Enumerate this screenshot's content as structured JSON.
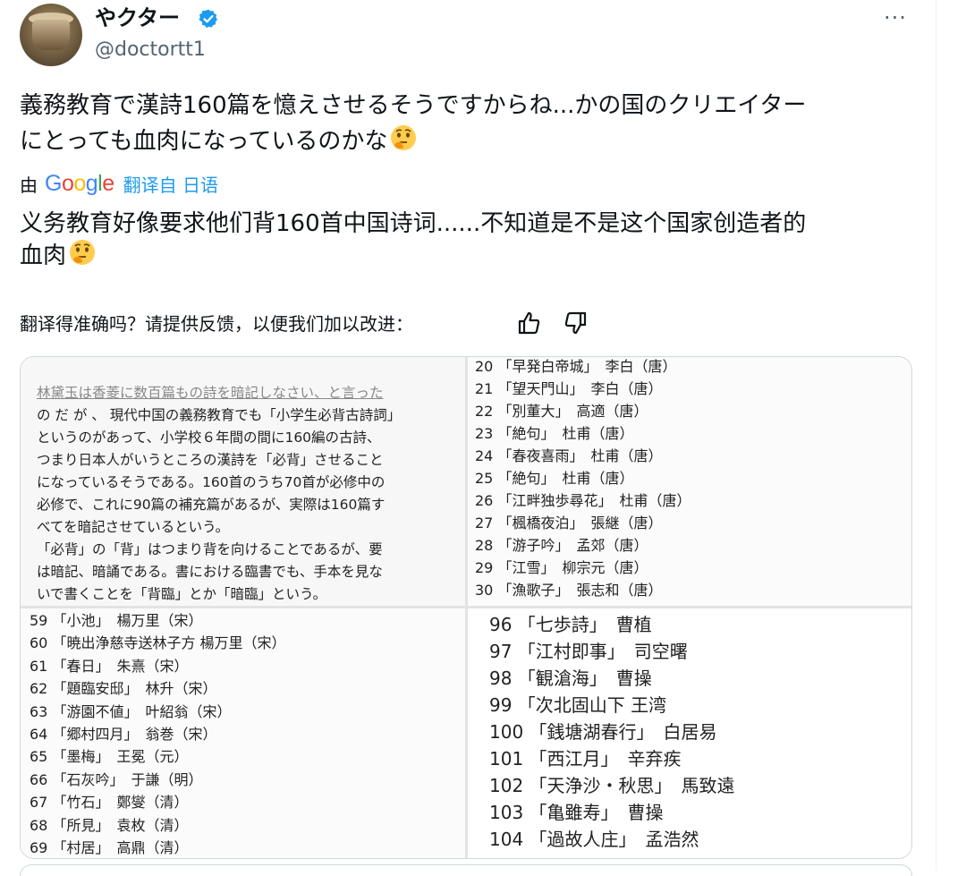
{
  "author": {
    "display_name": "やクター",
    "handle": "@doctortt1"
  },
  "tweet": {
    "original_line1": "義務教育で漢詩160篇を憶えさせるそうですからね...かの国のクリエイター",
    "original_line2": "にとっても血肉になっているのかな",
    "translated_prefix": "由",
    "translated_by_link": "翻译自 日语",
    "translation_line1": "义务教育好像要求他们背160首中国诗词......不知道是不是这个国家创造者的",
    "translation_line2": "血肉",
    "feedback_prompt": "翻译得准确吗？请提供反馈，以便我们加以改进：",
    "more_label": "···"
  },
  "colors": {
    "text": "#0f1419",
    "secondary": "#536471",
    "link": "#1d9bf0",
    "verified": "#1d9bf0"
  },
  "icons": {
    "verified": "verified-badge-icon",
    "thumbs_up": "thumbs-up-icon",
    "thumbs_down": "thumbs-down-icon",
    "thinking": "thinking-face-emoji",
    "more": "more-icon"
  },
  "media": {
    "article_lines": [
      "の だ が 、 現代中国の義務教育でも「小学生必背古詩詞」",
      "というのがあって、小学校６年間の間に160編の古詩、",
      "つまり日本人がいうところの漢詩を「必背」させること",
      "になっているそうである。160首のうち70首が必修中の",
      "必修で、これに90篇の補充篇があるが、実際は160篇す",
      "べてを暗記させているという。",
      "「必背」の「背」はつまり背を向けることであるが、要",
      "は暗記、暗誦である。書における臨書でも、手本を見な",
      "いで書くことを「背臨」とか「暗臨」という。"
    ],
    "article_first_line": "林黛玉は香菱に数百篇もの詩を暗記しなさい、と言った",
    "list_top_right": [
      "20 「早発白帝城」　李白（唐）",
      "21 「望天門山」　李白（唐）",
      "22 「別董大」　高適（唐）",
      "23 「絶句」　杜甫（唐）",
      "24 「春夜喜雨」　杜甫（唐）",
      "25 「絶句」　杜甫（唐）",
      "26 「江畔独歩尋花」　杜甫（唐）",
      "27 「楓橋夜泊」　張継（唐）",
      "28 「游子吟」　孟郊（唐）",
      "29 「江雪」　柳宗元（唐）",
      "30 「漁歌子」　張志和（唐）"
    ],
    "list_bottom_left": [
      "59 「小池」　楊万里（宋）",
      "60 「暁出浄慈寺送林子方 楊万里（宋）",
      "61 「春日」　朱熹（宋）",
      "62 「題臨安邸」　林升（宋）",
      "63 「游園不値」　叶紹翁（宋）",
      "64 「郷村四月」　翁巻（宋）",
      "65 「墨梅」　王冕（元）",
      "66 「石灰吟」　于謙（明）",
      "67 「竹石」　鄭燮（清）",
      "68 「所見」　袁枚（清）",
      "69 「村居」　高鼎（清）"
    ],
    "list_bottom_right": [
      "96 「七歩詩」　曹植",
      "97 「江村即事」　司空曙",
      "98 「観滄海」　曹操",
      "99 「次北固山下 王湾",
      "100 「銭塘湖春行」　白居易",
      "101 「西江月」　辛弃疾",
      "102 「天浄沙・秋思」　馬致遠",
      "103 「亀雖寿」　曹操",
      "104 「過故人庄」　孟浩然"
    ]
  }
}
